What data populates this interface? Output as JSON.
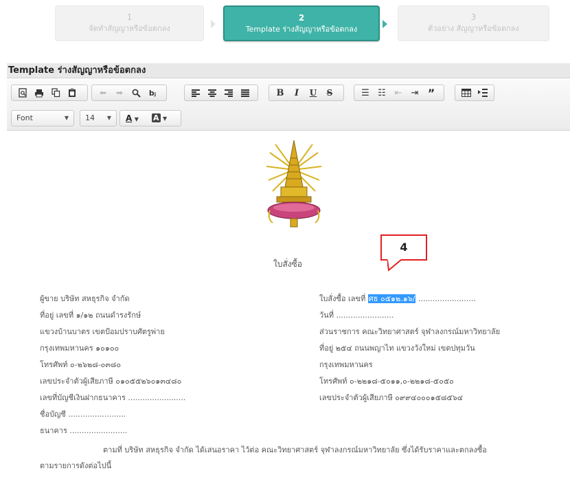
{
  "wizard": {
    "steps": [
      {
        "num": "1",
        "label": "จัดทำสัญญาหรือข้อตกลง",
        "state": "inactive"
      },
      {
        "num": "2",
        "label": "Template ร่างสัญญาหรือข้อตกลง",
        "state": "active"
      },
      {
        "num": "3",
        "label": "ตัวอย่าง สัญญาหรือข้อตกลง",
        "state": "inactive"
      }
    ]
  },
  "editor": {
    "title": "Template ร่างสัญญาหรือข้อตกลง",
    "font_dropdown": "Font",
    "size_dropdown": "14",
    "text_color_label": "A",
    "bg_color_label": "A"
  },
  "document": {
    "heading": "ใบสั่งซื้อ",
    "callout": "4",
    "seller": {
      "name": "ผู้ขาย  บริษัท สหธุรกิจ จำกัด",
      "address": "ที่อยู่  เลขที่ ๑/๑๒ ถนนดำรงรักษ์",
      "district": "แขวงบ้านบาตร เขตป้อมปราบศัตรูพ่าย",
      "city": "กรุงเทพมหานคร ๑๐๑๐๐",
      "phone": "โทรศัพท์  ๐-๒๖๒๘-๐๓๘๐",
      "tax_id": "เลขประจำตัวผู้เสียภาษี  ๐๑๐๕๕๒๖๐๑๓๔๘๐",
      "bank_account": "เลขที่บัญชีเงินฝากธนาคาร   ........................",
      "account_name": "ชื่อบัญชี   ........................",
      "bank": "ธนาคาร   ........................"
    },
    "buyer": {
      "po_label": "ใบสั่งซื้อ เลขที่",
      "po_number": "ศธ ๐๕๑๒.๑๖/",
      "po_dots": "........................",
      "date": "วันที่   ........................",
      "unit": "ส่วนราชการ  คณะวิทยาศาสตร์ จุฬาลงกรณ์มหาวิทยาลัย",
      "address": "ที่อยู่  ๒๕๔ ถนนพญาไท แขวงวังใหม่ เขตปทุมวัน",
      "city": "กรุงเทพมหานคร",
      "phone": "โทรศัพท์  ๐-๒๒๑๘-๕๐๑๑,๐-๒๒๑๘-๕๐๕๐",
      "tax_id": "เลขประจำตัวผู้เสียภาษี ๐๙๙๔๐๐๐๑๕๘๕๖๔"
    },
    "paragraph_line1": "ตามที่ บริษัท สหธุรกิจ จำกัด ได้เสนอราคา ไว้ต่อ คณะวิทยาศาสตร์ จุฬาลงกรณ์มหาวิทยาลัย ซึ่งได้รับราคาและตกลงซื้อ",
    "paragraph_line2": "ตามรายการดังต่อไปนี้"
  },
  "colors": {
    "active_step": "#3fb3a7",
    "callout_border": "#e02020",
    "selection": "#3399ff"
  }
}
